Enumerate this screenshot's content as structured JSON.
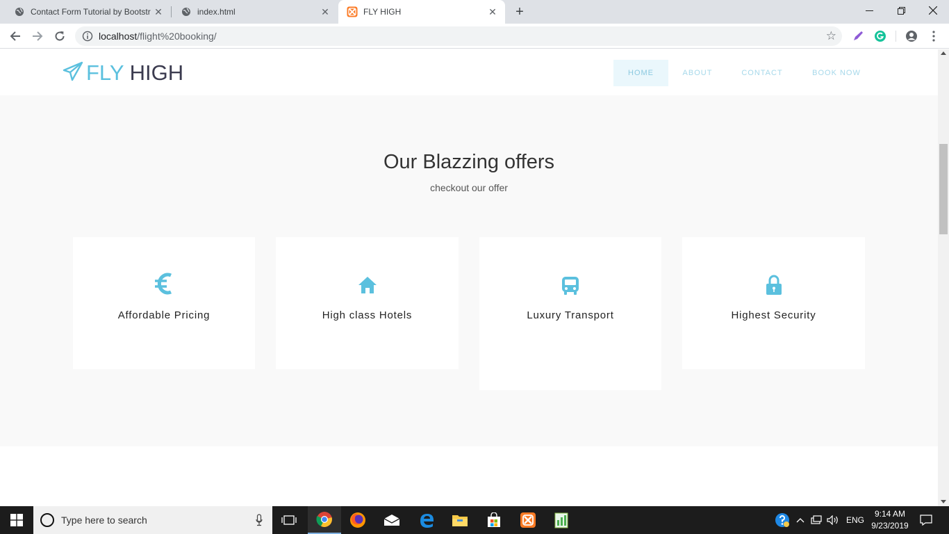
{
  "browser": {
    "tabs": [
      {
        "title": "Contact Form Tutorial by Bootstr",
        "active": false
      },
      {
        "title": "index.html",
        "active": false
      },
      {
        "title": "FLY HIGH",
        "active": true
      }
    ],
    "new_tab_label": "+",
    "url_host": "localhost",
    "url_path": "/flight%20booking/"
  },
  "site": {
    "logo_fly": "FLY",
    "logo_high": "HIGH",
    "nav": [
      {
        "label": "HOME",
        "active": true
      },
      {
        "label": "ABOUT",
        "active": false
      },
      {
        "label": "CONTACT",
        "active": false
      },
      {
        "label": "BOOK NOW",
        "active": false
      }
    ],
    "offers_title": "Our Blazzing offers",
    "offers_subtitle": "checkout our offer",
    "cards": [
      {
        "label": "Affordable Pricing",
        "icon": "euro-icon"
      },
      {
        "label": "High class Hotels",
        "icon": "home-icon"
      },
      {
        "label": "Luxury Transport",
        "icon": "bus-icon"
      },
      {
        "label": "Highest Security",
        "icon": "lock-icon"
      }
    ],
    "accent_color": "#5bc0de"
  },
  "taskbar": {
    "search_placeholder": "Type here to search",
    "language": "ENG",
    "time": "9:14 AM",
    "date": "9/23/2019"
  }
}
